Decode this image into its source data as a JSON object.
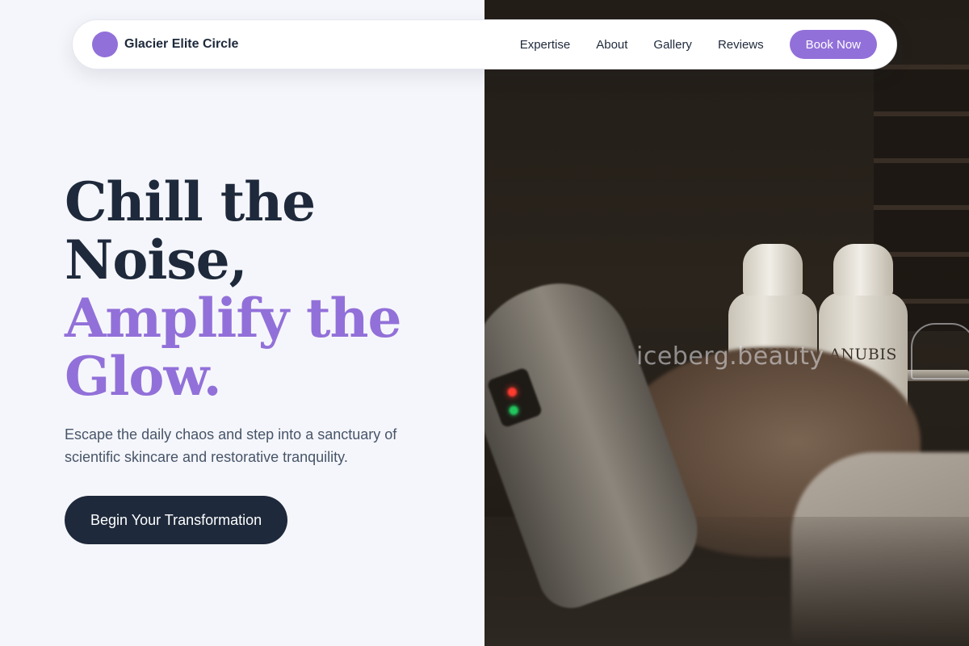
{
  "nav": {
    "brand": "Glacier Elite Circle",
    "links": [
      "Expertise",
      "About",
      "Gallery",
      "Reviews"
    ],
    "cta": "Book Now"
  },
  "hero": {
    "headline_dark": [
      "Chill the",
      "Noise,"
    ],
    "headline_accent": [
      "Amplify the",
      "Glow."
    ],
    "subtext": "Escape the daily chaos and step into a sanctuary of scientific skincare and restorative tranquility.",
    "cta": "Begin Your Transformation"
  },
  "photo": {
    "bottle_label": "ANUBIS",
    "watermark": "iceberg.beauty"
  },
  "colors": {
    "accent": "#9270d9",
    "dark": "#1e293b",
    "background": "#f5f6fb",
    "muted_text": "#475569"
  },
  "icons": {
    "logo": "purple-circle-logo-icon"
  }
}
